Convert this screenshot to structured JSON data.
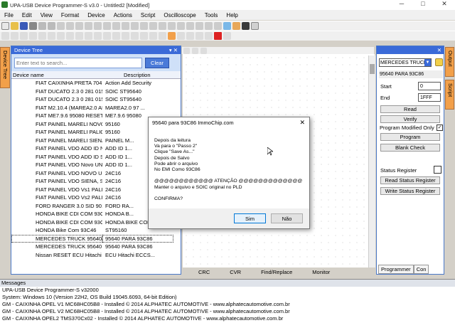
{
  "window": {
    "title": "UPA-USB Device Programmer-S v3.0 - Untitled2 [Modified]",
    "minimize": "─",
    "maximize": "□",
    "close": "✕"
  },
  "menu": [
    "File",
    "Edit",
    "View",
    "Format",
    "Device",
    "Actions",
    "Script",
    "Oscilloscope",
    "Tools",
    "Help"
  ],
  "left_tab": "Device Tree",
  "device_tree": {
    "title": "Device Tree",
    "pin": "▾ ✕",
    "search_placeholder": "Enter text to search...",
    "clear_label": "Clear",
    "col_name": "Device name",
    "col_desc": "Description",
    "rows": [
      {
        "name": "FIAT CAIXINHA PRETA 704",
        "desc": "Action Add Security"
      },
      {
        "name": "FIAT DUCATO 2.3 0 281 015 223 ...",
        "desc": "SOIC ST95640"
      },
      {
        "name": "FIAT DUCATO 2.3 0 281 015 223 ...",
        "desc": "SOIC ST95640"
      },
      {
        "name": "FIAT M2.10.4 (MAREA2.0 ANO 97 ...",
        "desc": "MAREA2.0 97 ..."
      },
      {
        "name": "FIAT ME7.9.6 95080 RESET",
        "desc": "ME7.9.6 95080"
      },
      {
        "name": "FIAT PAINEL MARELI NOVO UNO ...",
        "desc": "95160"
      },
      {
        "name": "FIAT PAINEL MARELI PALIO/STR...",
        "desc": "95160"
      },
      {
        "name": "FIAT PAINEL MARELI SIENA, STR...",
        "desc": "PAINEL M..."
      },
      {
        "name": "FIAT PAINEL VDO ADD ID NOVO ...",
        "desc": "ADD ID 1..."
      },
      {
        "name": "FIAT PAINEL VDO ADD ID SIENA, ...",
        "desc": "ADD ID 1..."
      },
      {
        "name": "FIAT PAINEL VDO Novo UNO (Stra...",
        "desc": "ADD ID 1..."
      },
      {
        "name": "FIAT PAINEL VDO NOVO UNO 24...",
        "desc": "24C16"
      },
      {
        "name": "FIAT PAINEL VDO SIENA, STRADA...",
        "desc": "24C16"
      },
      {
        "name": "FIAT PAINEL VDO Vs1 PALIO/STR...",
        "desc": "24C16"
      },
      {
        "name": "FIAT PAINEL VDO Vs2 PALIO/STR...",
        "desc": "24C16"
      },
      {
        "name": "FORD RANGER 3.0 SID 901C SE...",
        "desc": "FORD RA..."
      },
      {
        "name": "HONDA BIKE CDI COM 93C46 By...",
        "desc": "HONDA B..."
      },
      {
        "name": "HONDA BIKE CDI COM 93C66 By...",
        "desc": "HONDA BIKE COM 9..."
      },
      {
        "name": "HONDA Bike Com 93C46",
        "desc": "ST95160"
      },
      {
        "name": "MERCEDES TRUCK 95640 PARA ...",
        "desc": "95640 PARA 93C86"
      },
      {
        "name": "MERCEDES TRUCK 95640 PARA ...",
        "desc": "95640 PARA 93C86"
      },
      {
        "name": "Nissan RESET ECU Hitachi ECC...",
        "desc": "ECU  Hitachi ECCS..."
      }
    ],
    "selected_index": 19
  },
  "bottom_tabs": [
    "CRC",
    "CVR",
    "Find/Replace",
    "Monitor"
  ],
  "right_panel": {
    "device_select": "MERCEDES TRUCK",
    "device_name": "95640 PARA 93C86",
    "start_label": "Start",
    "start_value": "0",
    "end_label": "End",
    "end_value": "1FFF",
    "read_label": "Read",
    "verify_label": "Verify",
    "prog_mod_label": "Program Modified Only",
    "prog_mod_checked": "✓",
    "program_label": "Program",
    "blank_label": "Blank Check",
    "status_reg_label": "Status Register",
    "read_status_label": "Read Status Register",
    "write_status_label": "Write Status Register",
    "tab_programmer": "Programmer",
    "tab_con": "Con"
  },
  "right_tabs": [
    "Output",
    "Script"
  ],
  "messages": {
    "title": "Messages",
    "lines": [
      "UPA-USB Device Programmer-S v32000",
      "System: Windows 10 (Version 22H2, OS Build 19045.6093, 64-bit Edition)",
      "GM - CAIXINHA OPEL V1 MC68HC05B8 - Installed © 2014 ALPHATEC AUTOMOTIVE - www.alphatecautomotive.com.br",
      "GM - CAIXINHA OPEL V2 MC68HC05B8 - Installed © 2014 ALPHATEC AUTOMOTIVE - www.alphatecautomotive.com.br",
      "GM - CAIXINHA OPEL2 TMS370Cx02 - Installed © 2014 ALPHATEC AUTOMOTIVE - www.alphatecautomotive.com.br"
    ]
  },
  "dialog": {
    "title": "95640 para 93C86 ImmoChip.com",
    "close": "✕",
    "lines": [
      "Depois da leitura",
      "Va para o \"Passo 2\"",
      "Clique \"Save As...\"",
      "Depois de Salvo",
      "Pode abrir o arquivo",
      "No EMI Como 93C86",
      " ",
      "@@@@@@@@@@@@   ATENÇÃO   @@@@@@@@@@@@@",
      "Manter o arquivo e SOIC original no PLD",
      " ",
      "CONFIRMA?"
    ],
    "yes_label": "Sim",
    "no_label": "Não"
  }
}
